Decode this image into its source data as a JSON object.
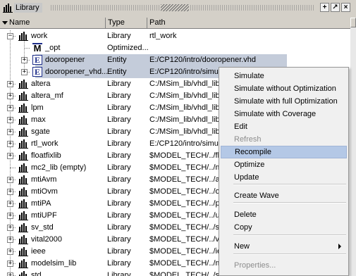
{
  "window": {
    "title": "Library",
    "buttons": [
      "+",
      "↗",
      "×"
    ]
  },
  "columns": {
    "name": "Name",
    "type": "Type",
    "path": "Path"
  },
  "rows": [
    {
      "name": "work",
      "type": "Library",
      "path": "rtl_work",
      "icon": "library-icon",
      "expander": "−",
      "indent": 0,
      "selected": false
    },
    {
      "name": "_opt",
      "type": "Optimized...",
      "path": "",
      "icon": "optimized-design-icon",
      "expander": "",
      "indent": 1,
      "selected": false
    },
    {
      "name": "dooropener",
      "type": "Entity",
      "path": "E:/CP120/intro/dooropener.vhd",
      "icon": "entity-icon",
      "expander": "+",
      "indent": 1,
      "selected": true
    },
    {
      "name": "dooropener_vhd...",
      "type": "Entity",
      "path": "E:/CP120/intro/simu",
      "icon": "entity-icon",
      "expander": "+",
      "indent": 1,
      "selected": true
    },
    {
      "name": "altera",
      "type": "Library",
      "path": "C:/MSim_lib/vhdl_lib",
      "icon": "library-icon",
      "expander": "+",
      "indent": 0,
      "selected": false
    },
    {
      "name": "altera_mf",
      "type": "Library",
      "path": "C:/MSim_lib/vhdl_lib",
      "icon": "library-icon",
      "expander": "+",
      "indent": 0,
      "selected": false
    },
    {
      "name": "lpm",
      "type": "Library",
      "path": "C:/MSim_lib/vhdl_lib",
      "icon": "library-icon",
      "expander": "+",
      "indent": 0,
      "selected": false
    },
    {
      "name": "max",
      "type": "Library",
      "path": "C:/MSim_lib/vhdl_lib",
      "icon": "library-icon",
      "expander": "+",
      "indent": 0,
      "selected": false
    },
    {
      "name": "sgate",
      "type": "Library",
      "path": "C:/MSim_lib/vhdl_lib",
      "icon": "library-icon",
      "expander": "+",
      "indent": 0,
      "selected": false
    },
    {
      "name": "rtl_work",
      "type": "Library",
      "path": "E:/CP120/intro/simu",
      "icon": "library-icon",
      "expander": "+",
      "indent": 0,
      "selected": false
    },
    {
      "name": "floatfixlib",
      "type": "Library",
      "path": "$MODEL_TECH/../flo",
      "icon": "library-icon",
      "expander": "+",
      "indent": 0,
      "selected": false
    },
    {
      "name": "mc2_lib  (empty)",
      "type": "Library",
      "path": "$MODEL_TECH/../mc",
      "icon": "library-icon",
      "expander": "",
      "indent": 0,
      "selected": false
    },
    {
      "name": "mtiAvm",
      "type": "Library",
      "path": "$MODEL_TECH/../av",
      "icon": "library-icon",
      "expander": "+",
      "indent": 0,
      "selected": false
    },
    {
      "name": "mtiOvm",
      "type": "Library",
      "path": "$MODEL_TECH/../ov",
      "icon": "library-icon",
      "expander": "+",
      "indent": 0,
      "selected": false
    },
    {
      "name": "mtiPA",
      "type": "Library",
      "path": "$MODEL_TECH/../pa",
      "icon": "library-icon",
      "expander": "+",
      "indent": 0,
      "selected": false
    },
    {
      "name": "mtiUPF",
      "type": "Library",
      "path": "$MODEL_TECH/../up",
      "icon": "library-icon",
      "expander": "+",
      "indent": 0,
      "selected": false
    },
    {
      "name": "sv_std",
      "type": "Library",
      "path": "$MODEL_TECH/../sv",
      "icon": "library-icon",
      "expander": "+",
      "indent": 0,
      "selected": false
    },
    {
      "name": "vital2000",
      "type": "Library",
      "path": "$MODEL_TECH/../vit",
      "icon": "library-icon",
      "expander": "+",
      "indent": 0,
      "selected": false
    },
    {
      "name": "ieee",
      "type": "Library",
      "path": "$MODEL_TECH/../ie",
      "icon": "library-icon",
      "expander": "+",
      "indent": 0,
      "selected": false
    },
    {
      "name": "modelsim_lib",
      "type": "Library",
      "path": "$MODEL_TECH/../mo",
      "icon": "library-icon",
      "expander": "+",
      "indent": 0,
      "selected": false
    },
    {
      "name": "std",
      "type": "Library",
      "path": "$MODEL_TECH/../st",
      "icon": "library-icon",
      "expander": "+",
      "indent": 0,
      "selected": false
    }
  ],
  "context_menu": {
    "items": [
      {
        "label": "Simulate",
        "disabled": false,
        "highlighted": false
      },
      {
        "label": "Simulate without Optimization",
        "disabled": false,
        "highlighted": false
      },
      {
        "label": "Simulate with full Optimization",
        "disabled": false,
        "highlighted": false
      },
      {
        "label": "Simulate with Coverage",
        "disabled": false,
        "highlighted": false
      },
      {
        "label": "Edit",
        "disabled": false,
        "highlighted": false
      },
      {
        "label": "Refresh",
        "disabled": true,
        "highlighted": false
      },
      {
        "label": "Recompile",
        "disabled": false,
        "highlighted": true
      },
      {
        "label": "Optimize",
        "disabled": false,
        "highlighted": false
      },
      {
        "label": "Update",
        "disabled": false,
        "highlighted": false
      },
      {
        "label": "Create Wave",
        "disabled": false,
        "highlighted": false
      },
      {
        "label": "Delete",
        "disabled": false,
        "highlighted": false
      },
      {
        "label": "Copy",
        "disabled": false,
        "highlighted": false
      },
      {
        "label": "New",
        "disabled": false,
        "highlighted": false,
        "submenu": true
      },
      {
        "label": "Properties...",
        "disabled": true,
        "highlighted": false
      }
    ]
  },
  "colors": {
    "selection": "#c4ccda",
    "menu_highlight": "#b4c8e6",
    "entity_icon": "#1e2e8a"
  }
}
